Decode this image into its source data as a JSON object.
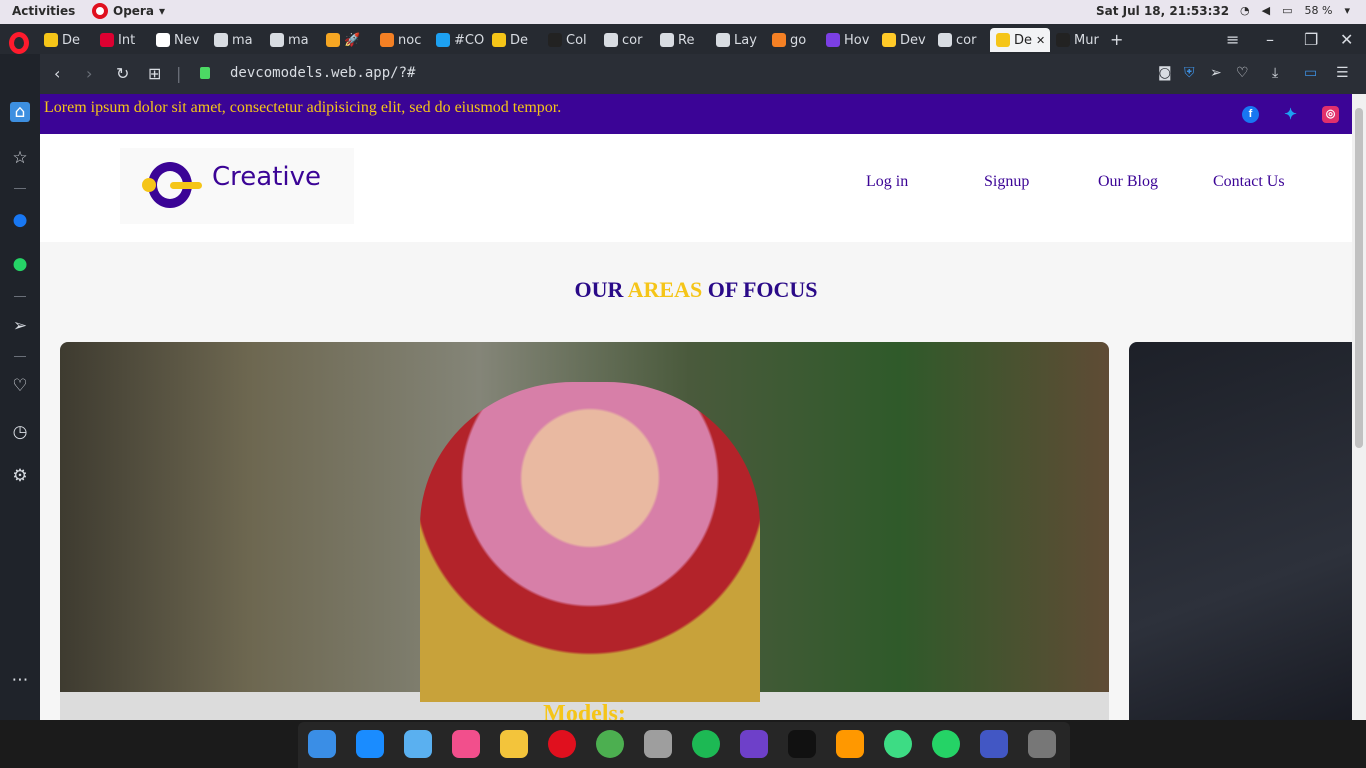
{
  "system": {
    "activities": "Activities",
    "app_name": "Opera",
    "clock": "Sat Jul 18, 21:53:32",
    "battery": "58 %"
  },
  "tabs": [
    {
      "label": "De",
      "icon": "devco-icon",
      "color": "#f5c518"
    },
    {
      "label": "Int",
      "icon": "angular-icon",
      "color": "#dd0031"
    },
    {
      "label": "Nev",
      "icon": "github-icon",
      "color": "#ffffff"
    },
    {
      "label": "ma",
      "icon": "doc-icon",
      "color": "#d8dce2"
    },
    {
      "label": "ma",
      "icon": "doc-icon",
      "color": "#d8dce2"
    },
    {
      "label": "🚀",
      "icon": "emoji-icon",
      "color": "#f5a623"
    },
    {
      "label": "noc",
      "icon": "stackoverflow-icon",
      "color": "#f48024"
    },
    {
      "label": "#CO",
      "icon": "twitter-icon",
      "color": "#1da1f2"
    },
    {
      "label": "De",
      "icon": "devco-icon",
      "color": "#f5c518"
    },
    {
      "label": "Col",
      "icon": "cb-icon",
      "color": "#222222"
    },
    {
      "label": "cor",
      "icon": "doc-icon",
      "color": "#d8dce2"
    },
    {
      "label": "Re",
      "icon": "doc-icon",
      "color": "#d8dce2"
    },
    {
      "label": "Lay",
      "icon": "doc-icon",
      "color": "#d8dce2"
    },
    {
      "label": "go",
      "icon": "stackoverflow-icon",
      "color": "#f48024"
    },
    {
      "label": "Hov",
      "icon": "firefox-icon",
      "color": "#7b3fe4"
    },
    {
      "label": "Dev",
      "icon": "firebase-icon",
      "color": "#ffca28"
    },
    {
      "label": "cor",
      "icon": "doc-icon",
      "color": "#d8dce2"
    },
    {
      "label": "De",
      "icon": "devco-icon",
      "color": "#f5c518",
      "active": true
    },
    {
      "label": "Mur",
      "icon": "codepen-icon",
      "color": "#222222"
    }
  ],
  "address": {
    "url": "devcomodels.web.app/?#"
  },
  "page": {
    "promo_text": "Lorem ipsum dolor sit amet, consectetur adipisicing elit, sed do eiusmod tempor.",
    "logo_text": "Creative",
    "nav": [
      "Log in",
      "Signup",
      "Our Blog",
      "Contact Us"
    ],
    "focus_title": {
      "part1": "OUR",
      "highlight": "AREAS",
      "part2": "OF FOCUS"
    },
    "card_caption": "Models:"
  },
  "colors": {
    "brand_purple": "#3b0496",
    "brand_yellow": "#f5c518"
  }
}
